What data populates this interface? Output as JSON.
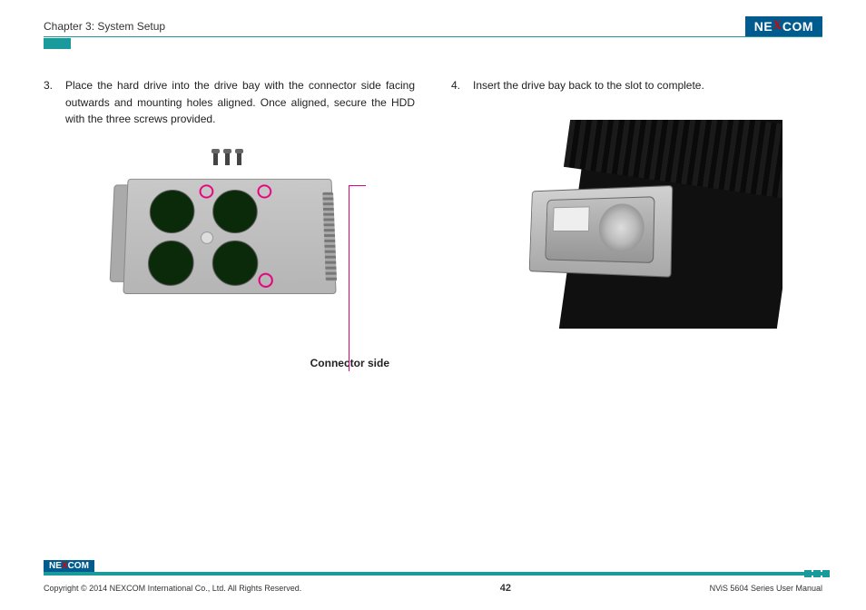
{
  "header": {
    "chapter": "Chapter 3: System Setup",
    "brand_left": "NE",
    "brand_x": "X",
    "brand_right": "COM"
  },
  "steps": {
    "s3_num": "3.",
    "s3_text": "Place the hard drive into the drive bay with the connector side facing outwards and mounting holes aligned. Once aligned, secure the HDD with the three screws provided.",
    "s4_num": "4.",
    "s4_text": "Insert the drive bay back to the slot to complete."
  },
  "callout": {
    "connector_side": "Connector side"
  },
  "footer": {
    "copyright": "Copyright © 2014 NEXCOM International Co., Ltd. All Rights Reserved.",
    "page": "42",
    "manual": "NViS 5604 Series User Manual",
    "brand_left": "NE",
    "brand_x": "X",
    "brand_right": "COM"
  }
}
